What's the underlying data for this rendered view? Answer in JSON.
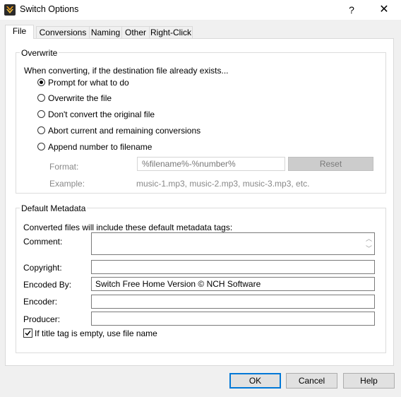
{
  "window": {
    "title": "Switch Options",
    "help_glyph": "?",
    "close_glyph": "✕"
  },
  "tabs": [
    {
      "label": "File"
    },
    {
      "label": "Conversions"
    },
    {
      "label": "Naming"
    },
    {
      "label": "Other"
    },
    {
      "label": "Right-Click"
    }
  ],
  "overwrite": {
    "group_label": "Overwrite",
    "intro": "When converting, if the destination file already exists...",
    "options": [
      {
        "label": "Prompt for what to do",
        "checked": true
      },
      {
        "label": "Overwrite the file",
        "checked": false
      },
      {
        "label": "Don't convert the original file",
        "checked": false
      },
      {
        "label": "Abort current and remaining conversions",
        "checked": false
      },
      {
        "label": "Append number to filename",
        "checked": false
      }
    ],
    "format_label": "Format:",
    "format_value": "%filename%-%number%",
    "reset_label": "Reset",
    "example_label": "Example:",
    "example_value": "music-1.mp3, music-2.mp3, music-3.mp3, etc."
  },
  "metadata": {
    "group_label": "Default Metadata",
    "intro": "Converted files will include these default metadata tags:",
    "comment_label": "Comment:",
    "comment_value": "",
    "copyright_label": "Copyright:",
    "copyright_value": "",
    "encoded_by_label": "Encoded By:",
    "encoded_by_value": "Switch Free Home Version © NCH Software",
    "encoder_label": "Encoder:",
    "encoder_value": "",
    "producer_label": "Producer:",
    "producer_value": "",
    "title_checkbox_label": "If title tag is empty, use file name",
    "title_checkbox_checked": true
  },
  "footer": {
    "ok_label": "OK",
    "cancel_label": "Cancel",
    "help_label": "Help"
  },
  "colors": {
    "accent": "#0078d7",
    "icon_orange": "#f39c12"
  }
}
